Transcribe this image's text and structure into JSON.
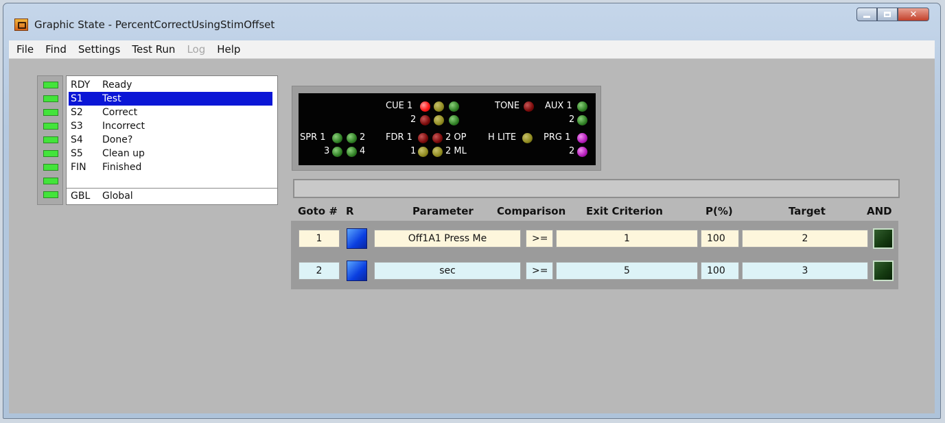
{
  "window": {
    "title": "Graphic State - PercentCorrectUsingStimOffset"
  },
  "menu": [
    {
      "label": "File",
      "enabled": true
    },
    {
      "label": "Find",
      "enabled": true
    },
    {
      "label": "Settings",
      "enabled": true
    },
    {
      "label": "Test Run",
      "enabled": true
    },
    {
      "label": "Log",
      "enabled": false
    },
    {
      "label": "Help",
      "enabled": true
    }
  ],
  "states": [
    {
      "code": "RDY",
      "name": "Ready",
      "selected": false
    },
    {
      "code": "S1",
      "name": "Test",
      "selected": true
    },
    {
      "code": "S2",
      "name": "Correct",
      "selected": false
    },
    {
      "code": "S3",
      "name": "Incorrect",
      "selected": false
    },
    {
      "code": "S4",
      "name": "Done?",
      "selected": false
    },
    {
      "code": "S5",
      "name": "Clean up",
      "selected": false
    },
    {
      "code": "FIN",
      "name": "Finished",
      "selected": false
    },
    {
      "code": "GBL",
      "name": "Global",
      "selected": false
    }
  ],
  "indicators": {
    "cue1": "CUE 1",
    "cue2": "2",
    "tone": "TONE",
    "aux1": "AUX 1",
    "aux2": "2",
    "spr1": "SPR 1",
    "spr2": "2",
    "spr3": "3",
    "spr4": "4",
    "fdr1": "FDR 1",
    "fdr2op": "2 OP",
    "fdr1b": "1",
    "fdr2ml": "2 ML",
    "hlite": "H LITE",
    "prg1": "PRG 1",
    "prg2": "2"
  },
  "colors": {
    "led_on": "#43e43b",
    "selected": "#0b16d6",
    "row1_bg": "#fdf6dc",
    "row2_bg": "#ddf3f7"
  },
  "table": {
    "headers": {
      "goto": "Goto #",
      "r": "R",
      "parameter": "Parameter",
      "comparison": "Comparison",
      "exit": "Exit Criterion",
      "p": "P(%)",
      "target": "Target",
      "and": "AND"
    },
    "rows": [
      {
        "goto": "1",
        "parameter": "Off1A1 Press Me",
        "comparison": ">=",
        "exit": "1",
        "p": "100",
        "target": "2"
      },
      {
        "goto": "2",
        "parameter": "sec",
        "comparison": ">=",
        "exit": "5",
        "p": "100",
        "target": "3"
      }
    ]
  }
}
